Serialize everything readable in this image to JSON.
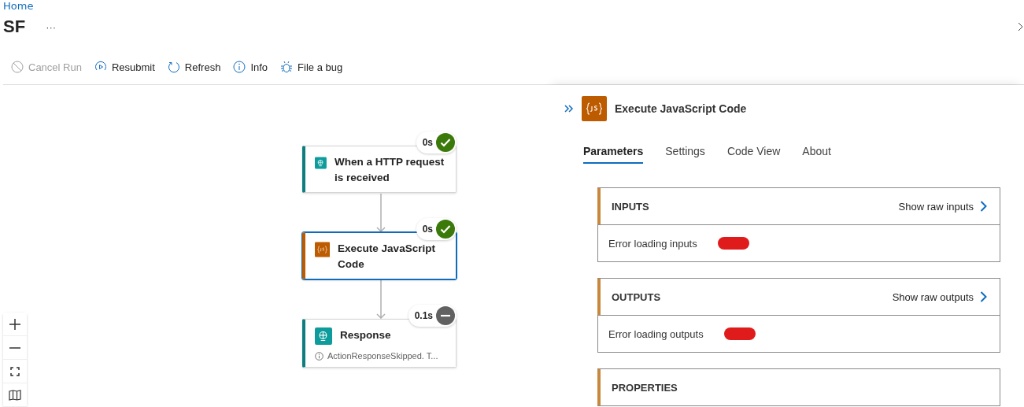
{
  "breadcrumb": {
    "items": [
      "Home"
    ]
  },
  "page": {
    "title": "SF",
    "more": "···"
  },
  "toolbar": [
    {
      "label": "Cancel Run",
      "disabled": true
    },
    {
      "label": "Resubmit",
      "disabled": false
    },
    {
      "label": "Refresh",
      "disabled": false
    },
    {
      "label": "Info",
      "disabled": false
    },
    {
      "label": "File a bug",
      "disabled": false
    }
  ],
  "nodes": [
    {
      "title": "When a HTTP request is received",
      "kind": "http",
      "duration": "0s",
      "succeeded": true,
      "selected": false
    },
    {
      "title": "Execute JavaScript Code",
      "kind": "js",
      "duration": "0s",
      "succeeded": true,
      "selected": true
    },
    {
      "title": "Response",
      "kind": "http",
      "duration": "0.1s",
      "succeeded": false,
      "selected": false,
      "message": "ActionResponseSkipped. T..."
    }
  ],
  "panel": {
    "title": "Execute JavaScript Code",
    "kind": "js",
    "tabs": [
      {
        "label": "Parameters",
        "selected": true
      },
      {
        "label": "Settings",
        "selected": false
      },
      {
        "label": "Code View",
        "selected": false
      },
      {
        "label": "About",
        "selected": false
      }
    ],
    "sections": [
      {
        "title": "INPUTS",
        "link": "Show raw inputs",
        "body": "Error loading inputs"
      },
      {
        "title": "OUTPUTS",
        "link": "Show raw outputs",
        "body": "Error loading outputs"
      },
      {
        "title": "PROPERTIES"
      }
    ]
  }
}
